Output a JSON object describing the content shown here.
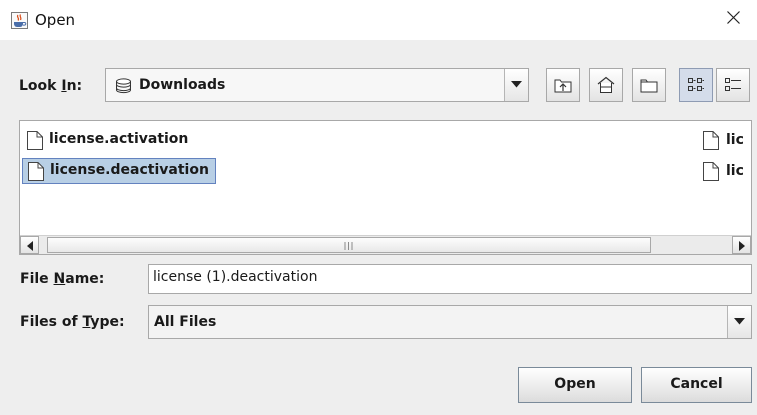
{
  "window": {
    "title": "Open",
    "app_icon": "java-cup-icon",
    "close_icon": "close-icon"
  },
  "look_in": {
    "label_pre": "Look ",
    "label_mnemonic": "I",
    "label_post": "n:",
    "value": "Downloads",
    "value_icon": "drive-icon"
  },
  "toolbar": {
    "buttons": [
      "up-one-level-icon",
      "home-icon",
      "new-folder-icon",
      "list-view-icon",
      "details-view-icon"
    ]
  },
  "files": {
    "column1": [
      {
        "name": "license.activation",
        "selected": false
      },
      {
        "name": "license.deactivation",
        "selected": true
      }
    ],
    "column2": [
      {
        "name": "lic"
      },
      {
        "name": "lic"
      }
    ]
  },
  "file_name": {
    "label_pre": "File ",
    "label_mnemonic": "N",
    "label_post": "ame:",
    "value": "license (1).deactivation"
  },
  "file_type": {
    "label_pre": "Files of ",
    "label_mnemonic": "T",
    "label_post": "ype:",
    "value": "All Files"
  },
  "buttons": {
    "open": "Open",
    "cancel": "Cancel"
  },
  "colors": {
    "selection": "#b8cfe5",
    "dialog_bg": "#eeeeee"
  }
}
